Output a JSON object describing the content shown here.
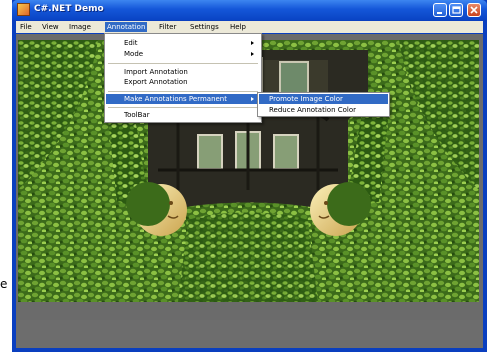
{
  "window": {
    "title": "C#.NET Demo"
  },
  "menubar": {
    "items": [
      {
        "label": "File"
      },
      {
        "label": "View"
      },
      {
        "label": "Image"
      },
      {
        "label": "Annotation"
      },
      {
        "label": "Filter"
      },
      {
        "label": "Settings"
      },
      {
        "label": "Help"
      }
    ],
    "active": "Annotation"
  },
  "annotation_menu": {
    "items": [
      {
        "label": "Edit",
        "submenu": true
      },
      {
        "label": "Mode",
        "submenu": true
      },
      {
        "label": "Import Annotation",
        "submenu": false
      },
      {
        "label": "Export Annotation",
        "submenu": false
      },
      {
        "label": "Make Annotations Permanent",
        "submenu": true,
        "highlighted": true
      },
      {
        "label": "ToolBar",
        "submenu": false
      }
    ]
  },
  "permanent_submenu": {
    "items": [
      {
        "label": "Promote Image Color",
        "highlighted": true
      },
      {
        "label": "Reduce Annotation Color"
      }
    ]
  },
  "stray_text": "e",
  "colors": {
    "titlebar": "#1557d9",
    "menu_highlight": "#316ac5",
    "menubar_bg": "#ece9d8",
    "ivy_dark": "#2f5a14",
    "ivy_light": "#7fb03a"
  },
  "icons": [
    "app-icon",
    "minimize-icon",
    "maximize-icon",
    "close-icon",
    "submenu-arrow-icon"
  ]
}
